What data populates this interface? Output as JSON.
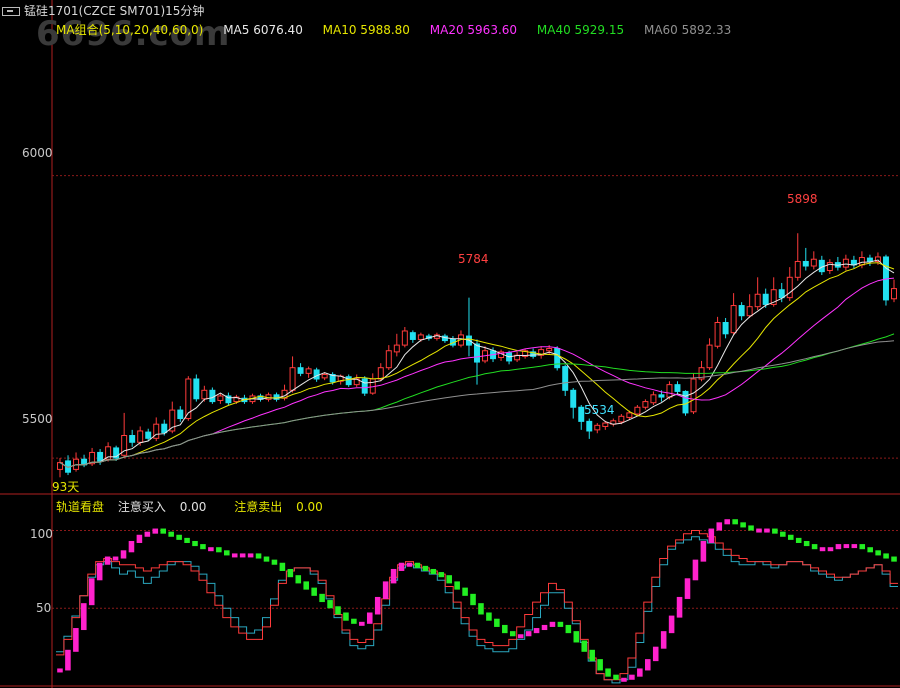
{
  "window": {
    "title": "锰硅1701(CZCE SM701)15分钟"
  },
  "watermark": {
    "text": "6696.com"
  },
  "ma_legend": {
    "group": {
      "label": "MA组合(5,10,20,40,60,0)",
      "color": "#e6e600"
    },
    "items": [
      {
        "label": "MA5 6076.40",
        "color": "#e8e8e8"
      },
      {
        "label": "MA10 5988.80",
        "color": "#e6e600"
      },
      {
        "label": "MA20 5963.60",
        "color": "#ff33ff"
      },
      {
        "label": "MA40 5929.15",
        "color": "#22dd22"
      },
      {
        "label": "MA60 5892.33",
        "color": "#909090"
      }
    ]
  },
  "price_axis": {
    "labels": [
      {
        "value": 6000,
        "text": "6000"
      },
      {
        "value": 5500,
        "text": "5500"
      }
    ]
  },
  "price_markers": {
    "high1": "5784",
    "high2": "5898",
    "low1": "5534"
  },
  "day_label": "93天",
  "indicator": {
    "name": "轨道看盘",
    "buy_label": "注意买入",
    "buy_value": "0.00",
    "sell_label": "注意卖出",
    "sell_value": "0.00",
    "axis_labels": [
      {
        "value": 100,
        "text": "100"
      },
      {
        "value": 50,
        "text": "50"
      }
    ]
  },
  "colors": {
    "up": "#ff3b3b",
    "down": "#22e0f0",
    "grid": "#8b1a1a",
    "frame": "#b02020"
  },
  "chart_data": [
    {
      "type": "candlestick",
      "title": "锰硅1701(CZCE SM701)15分钟",
      "ylim": [
        5440,
        6240
      ],
      "grid": true,
      "candles": [
        [
          5480,
          5492,
          5466,
          5500
        ],
        [
          5495,
          5475,
          5470,
          5505
        ],
        [
          5480,
          5498,
          5476,
          5510
        ],
        [
          5498,
          5488,
          5484,
          5506
        ],
        [
          5490,
          5510,
          5486,
          5518
        ],
        [
          5510,
          5495,
          5488,
          5516
        ],
        [
          5498,
          5520,
          5494,
          5528
        ],
        [
          5518,
          5500,
          5495,
          5522
        ],
        [
          5505,
          5540,
          5500,
          5580
        ],
        [
          5540,
          5528,
          5520,
          5550
        ],
        [
          5528,
          5548,
          5522,
          5556
        ],
        [
          5546,
          5535,
          5530,
          5552
        ],
        [
          5535,
          5560,
          5530,
          5572
        ],
        [
          5560,
          5545,
          5540,
          5568
        ],
        [
          5548,
          5585,
          5544,
          5600
        ],
        [
          5585,
          5570,
          5564,
          5592
        ],
        [
          5570,
          5640,
          5566,
          5645
        ],
        [
          5640,
          5605,
          5600,
          5648
        ],
        [
          5605,
          5620,
          5600,
          5628
        ],
        [
          5620,
          5600,
          5596,
          5625
        ],
        [
          5602,
          5610,
          5596,
          5614
        ],
        [
          5610,
          5598,
          5594,
          5616
        ],
        [
          5600,
          5608,
          5596,
          5612
        ],
        [
          5606,
          5600,
          5596,
          5612
        ],
        [
          5600,
          5610,
          5596,
          5614
        ],
        [
          5610,
          5604,
          5600,
          5614
        ],
        [
          5604,
          5612,
          5600,
          5616
        ],
        [
          5612,
          5604,
          5600,
          5616
        ],
        [
          5606,
          5620,
          5602,
          5630
        ],
        [
          5620,
          5660,
          5616,
          5680
        ],
        [
          5660,
          5650,
          5645,
          5668
        ],
        [
          5650,
          5658,
          5642,
          5662
        ],
        [
          5656,
          5640,
          5635,
          5660
        ],
        [
          5642,
          5648,
          5638,
          5652
        ],
        [
          5648,
          5635,
          5630,
          5652
        ],
        [
          5636,
          5645,
          5630,
          5648
        ],
        [
          5644,
          5630,
          5626,
          5648
        ],
        [
          5630,
          5640,
          5626,
          5648
        ],
        [
          5640,
          5615,
          5610,
          5645
        ],
        [
          5615,
          5640,
          5612,
          5650
        ],
        [
          5640,
          5660,
          5636,
          5668
        ],
        [
          5660,
          5690,
          5656,
          5700
        ],
        [
          5688,
          5700,
          5680,
          5720
        ],
        [
          5700,
          5725,
          5696,
          5732
        ],
        [
          5722,
          5710,
          5704,
          5726
        ],
        [
          5710,
          5718,
          5706,
          5722
        ],
        [
          5716,
          5712,
          5708,
          5720
        ],
        [
          5712,
          5718,
          5708,
          5722
        ],
        [
          5716,
          5708,
          5704,
          5720
        ],
        [
          5710,
          5700,
          5696,
          5716
        ],
        [
          5700,
          5718,
          5696,
          5726
        ],
        [
          5716,
          5700,
          5680,
          5784
        ],
        [
          5702,
          5670,
          5630,
          5710
        ],
        [
          5672,
          5690,
          5668,
          5698
        ],
        [
          5690,
          5676,
          5670,
          5696
        ],
        [
          5678,
          5688,
          5672,
          5692
        ],
        [
          5686,
          5672,
          5666,
          5690
        ],
        [
          5674,
          5682,
          5670,
          5688
        ],
        [
          5680,
          5690,
          5676,
          5694
        ],
        [
          5688,
          5680,
          5676,
          5694
        ],
        [
          5682,
          5692,
          5676,
          5698
        ],
        [
          5690,
          5694,
          5684,
          5700
        ],
        [
          5694,
          5660,
          5655,
          5698
        ],
        [
          5662,
          5620,
          5610,
          5665
        ],
        [
          5620,
          5590,
          5570,
          5624
        ],
        [
          5590,
          5565,
          5550,
          5594
        ],
        [
          5565,
          5548,
          5534,
          5570
        ],
        [
          5550,
          5558,
          5544,
          5562
        ],
        [
          5556,
          5562,
          5550,
          5566
        ],
        [
          5560,
          5566,
          5556,
          5570
        ],
        [
          5564,
          5574,
          5560,
          5578
        ],
        [
          5572,
          5580,
          5568,
          5584
        ],
        [
          5578,
          5590,
          5574,
          5594
        ],
        [
          5590,
          5600,
          5586,
          5604
        ],
        [
          5598,
          5612,
          5594,
          5618
        ],
        [
          5612,
          5608,
          5600,
          5620
        ],
        [
          5608,
          5630,
          5604,
          5636
        ],
        [
          5630,
          5618,
          5612,
          5636
        ],
        [
          5618,
          5580,
          5575,
          5620
        ],
        [
          5582,
          5640,
          5578,
          5650
        ],
        [
          5640,
          5660,
          5636,
          5672
        ],
        [
          5660,
          5700,
          5656,
          5712
        ],
        [
          5698,
          5740,
          5694,
          5750
        ],
        [
          5740,
          5720,
          5712,
          5748
        ],
        [
          5722,
          5770,
          5718,
          5792
        ],
        [
          5770,
          5752,
          5744,
          5776
        ],
        [
          5752,
          5768,
          5748,
          5790
        ],
        [
          5768,
          5790,
          5762,
          5820
        ],
        [
          5790,
          5772,
          5766,
          5800
        ],
        [
          5772,
          5798,
          5768,
          5820
        ],
        [
          5798,
          5784,
          5776,
          5810
        ],
        [
          5784,
          5820,
          5778,
          5838
        ],
        [
          5820,
          5848,
          5814,
          5898
        ],
        [
          5848,
          5840,
          5832,
          5872
        ],
        [
          5840,
          5852,
          5834,
          5866
        ],
        [
          5850,
          5830,
          5824,
          5858
        ],
        [
          5832,
          5846,
          5826,
          5852
        ],
        [
          5846,
          5838,
          5832,
          5856
        ],
        [
          5838,
          5852,
          5832,
          5860
        ],
        [
          5850,
          5842,
          5836,
          5858
        ],
        [
          5842,
          5855,
          5836,
          5866
        ],
        [
          5854,
          5848,
          5840,
          5860
        ],
        [
          5848,
          5856,
          5842,
          5864
        ],
        [
          5856,
          5780,
          5770,
          5860
        ],
        [
          5782,
          5800,
          5776,
          5816
        ]
      ],
      "ma_series": [
        {
          "name": "MA5",
          "color": "#e8e8e8",
          "period": 5
        },
        {
          "name": "MA10",
          "color": "#e6e600",
          "period": 10
        },
        {
          "name": "MA20",
          "color": "#ff33ff",
          "period": 20
        },
        {
          "name": "MA40",
          "color": "#22dd22",
          "period": 40
        },
        {
          "name": "MA60",
          "color": "#909090",
          "period": 60
        }
      ]
    },
    {
      "type": "line",
      "title": "轨道看盘",
      "ylim": [
        0,
        110
      ],
      "series": [
        {
          "name": "line_a",
          "color": "#2aa8c0",
          "values": [
            22,
            32,
            45,
            58,
            70,
            78,
            80,
            76,
            72,
            74,
            70,
            66,
            70,
            74,
            78,
            80,
            80,
            77,
            72,
            66,
            58,
            50,
            44,
            38,
            34,
            36,
            44,
            56,
            68,
            74,
            76,
            76,
            72,
            66,
            56,
            44,
            34,
            26,
            24,
            26,
            36,
            52,
            68,
            76,
            78,
            76,
            74,
            72,
            68,
            60,
            50,
            40,
            32,
            26,
            24,
            22,
            22,
            24,
            30,
            36,
            44,
            52,
            60,
            60,
            50,
            40,
            28,
            16,
            8,
            4,
            2,
            4,
            12,
            28,
            48,
            64,
            78,
            88,
            92,
            94,
            96,
            94,
            92,
            88,
            84,
            80,
            78,
            78,
            80,
            78,
            76,
            78,
            80,
            80,
            78,
            74,
            72,
            70,
            68,
            70,
            72,
            74,
            76,
            78,
            72,
            64
          ]
        },
        {
          "name": "line_b",
          "color": "#ff3b3b",
          "values": [
            20,
            30,
            44,
            58,
            72,
            80,
            82,
            80,
            78,
            78,
            76,
            74,
            76,
            78,
            80,
            80,
            78,
            74,
            68,
            60,
            52,
            44,
            38,
            34,
            30,
            30,
            38,
            52,
            66,
            74,
            76,
            76,
            74,
            68,
            58,
            46,
            36,
            30,
            28,
            30,
            40,
            56,
            70,
            78,
            80,
            78,
            76,
            74,
            72,
            64,
            54,
            44,
            36,
            30,
            28,
            26,
            26,
            30,
            38,
            46,
            54,
            60,
            66,
            62,
            54,
            42,
            30,
            18,
            8,
            4,
            4,
            8,
            18,
            34,
            54,
            70,
            82,
            90,
            94,
            98,
            100,
            98,
            96,
            92,
            88,
            84,
            82,
            80,
            80,
            80,
            78,
            78,
            80,
            80,
            78,
            76,
            74,
            72,
            70,
            70,
            72,
            74,
            76,
            78,
            74,
            66
          ]
        },
        {
          "name": "line_c",
          "color": "#ff22cc",
          "values": [
            10,
            22,
            36,
            52,
            68,
            78,
            82,
            82,
            86,
            92,
            96,
            98,
            100,
            98,
            96,
            94,
            92,
            90,
            88,
            88,
            86,
            84,
            84,
            84,
            84,
            82,
            80,
            78,
            74,
            70,
            66,
            62,
            58,
            54,
            50,
            46,
            42,
            40,
            40,
            46,
            56,
            66,
            74,
            78,
            78,
            76,
            74,
            72,
            70,
            66,
            62,
            58,
            52,
            46,
            42,
            38,
            34,
            32,
            32,
            34,
            36,
            38,
            40,
            38,
            34,
            28,
            22,
            16,
            10,
            6,
            4,
            4,
            6,
            10,
            16,
            24,
            34,
            44,
            56,
            68,
            80,
            92,
            100,
            104,
            106,
            104,
            102,
            100,
            100,
            100,
            98,
            96,
            94,
            92,
            90,
            88,
            88,
            88,
            90,
            90,
            90,
            88,
            86,
            84,
            82,
            80
          ]
        }
      ]
    }
  ]
}
